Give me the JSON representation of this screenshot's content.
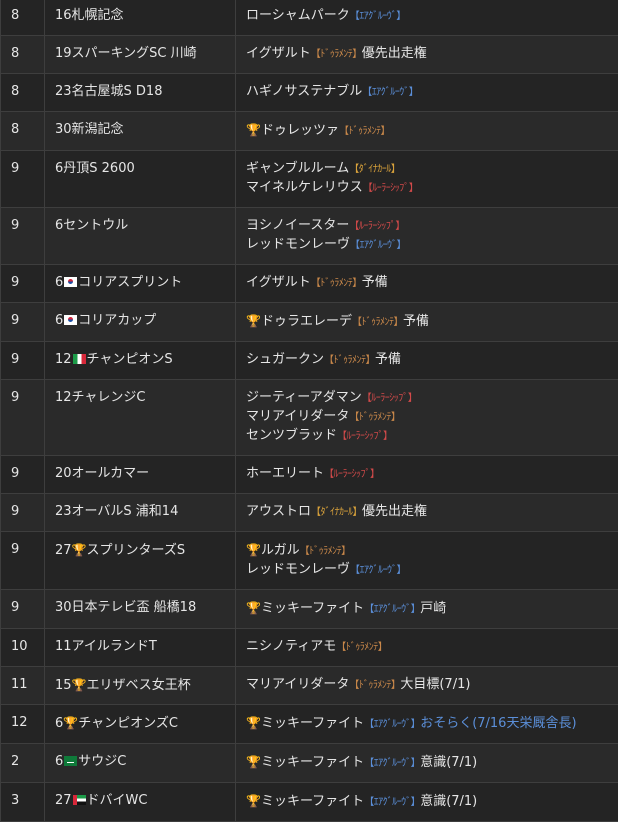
{
  "rows": [
    {
      "month": "8",
      "race": "16札幌記念",
      "horses": [
        {
          "name": "ローシャムパーク",
          "tag": "【ｴｱｸﾞﾙｰｳﾞ】",
          "tagType": "air"
        }
      ]
    },
    {
      "month": "8",
      "race": "19スパーキングSC 川崎",
      "horses": [
        {
          "name": "イグザルト",
          "tag": "【ﾄﾞｩﾗﾒﾝﾃ】",
          "tagType": "dura",
          "note": "優先出走権"
        }
      ]
    },
    {
      "month": "8",
      "race": "23名古屋城S D18",
      "horses": [
        {
          "name": "ハギノサステナブル",
          "tag": "【ｴｱｸﾞﾙｰｳﾞ】",
          "tagType": "air"
        }
      ]
    },
    {
      "month": "8",
      "race": "30新潟記念",
      "horses": [
        {
          "trophy": true,
          "name": "ドゥレッツァ",
          "tag": "【ﾄﾞｩﾗﾒﾝﾃ】",
          "tagType": "dura"
        }
      ]
    },
    {
      "month": "9",
      "race": "6丹頂S 2600",
      "horses": [
        {
          "name": "ギャンブルルーム",
          "tag": "【ﾀﾞｲﾅｶｰﾙ】",
          "tagType": "dyna"
        },
        {
          "name": "マイネルケレリウス",
          "tag": "【ﾙｰﾗｰｼｯﾌﾟ】",
          "tagType": "ruler"
        }
      ]
    },
    {
      "month": "9",
      "race": "6セントウル",
      "horses": [
        {
          "name": "ヨシノイースター",
          "tag": "【ﾙｰﾗｰｼｯﾌﾟ】",
          "tagType": "ruler"
        },
        {
          "name": "レッドモンレーヴ",
          "tag": "【ｴｱｸﾞﾙｰｳﾞ】",
          "tagType": "air"
        }
      ]
    },
    {
      "month": "9",
      "race": "6",
      "flag": "kr",
      "race2": "コリアスプリント",
      "horses": [
        {
          "name": "イグザルト",
          "tag": "【ﾄﾞｩﾗﾒﾝﾃ】",
          "tagType": "dura",
          "note": "予備"
        }
      ]
    },
    {
      "month": "9",
      "race": "6",
      "flag": "kr",
      "race2": "コリアカップ",
      "horses": [
        {
          "trophy": true,
          "name": "ドゥラエレーデ",
          "tag": "【ﾄﾞｩﾗﾒﾝﾃ】",
          "tagType": "dura",
          "note": "予備"
        }
      ]
    },
    {
      "month": "9",
      "race": "12",
      "flag": "it",
      "race2": "チャンピオンS",
      "horses": [
        {
          "name": "シュガークン",
          "tag": "【ﾄﾞｩﾗﾒﾝﾃ】",
          "tagType": "dura",
          "note": "予備"
        }
      ]
    },
    {
      "month": "9",
      "race": "12チャレンジC",
      "horses": [
        {
          "name": "ジーティーアダマン",
          "tag": "【ﾙｰﾗｰｼｯﾌﾟ】",
          "tagType": "ruler"
        },
        {
          "name": "マリアイリダータ",
          "tag": "【ﾄﾞｩﾗﾒﾝﾃ】",
          "tagType": "dura"
        },
        {
          "name": "センツブラッド",
          "tag": "【ﾙｰﾗｰｼｯﾌﾟ】",
          "tagType": "ruler"
        }
      ]
    },
    {
      "month": "9",
      "race": "20オールカマー",
      "horses": [
        {
          "name": "ホーエリート",
          "tag": "【ﾙｰﾗｰｼｯﾌﾟ】",
          "tagType": "ruler"
        }
      ]
    },
    {
      "month": "9",
      "race": "23オーバルS 浦和14",
      "horses": [
        {
          "name": "アウストロ",
          "tag": "【ﾀﾞｲﾅｶｰﾙ】",
          "tagType": "dyna",
          "note": "優先出走権"
        }
      ]
    },
    {
      "month": "9",
      "race": "27",
      "trophy": true,
      "race2": "スプリンターズS",
      "horses": [
        {
          "trophy": true,
          "name": "ルガル",
          "tag": "【ﾄﾞｩﾗﾒﾝﾃ】",
          "tagType": "dura"
        },
        {
          "name": "レッドモンレーヴ",
          "tag": "【ｴｱｸﾞﾙｰｳﾞ】",
          "tagType": "air"
        }
      ]
    },
    {
      "month": "9",
      "race": "30日本テレビ盃 船橋18",
      "horses": [
        {
          "trophy": true,
          "name": "ミッキーファイト",
          "tag": "【ｴｱｸﾞﾙｰｳﾞ】",
          "tagType": "air",
          "note": "戸崎"
        }
      ]
    },
    {
      "month": "10",
      "race": "11アイルランドT",
      "horses": [
        {
          "name": "ニシノティアモ",
          "tag": "【ﾄﾞｩﾗﾒﾝﾃ】",
          "tagType": "dura"
        }
      ]
    },
    {
      "month": "11",
      "race": "15",
      "trophy": true,
      "race2": "エリザベス女王杯",
      "horses": [
        {
          "name": "マリアイリダータ",
          "tag": "【ﾄﾞｩﾗﾒﾝﾃ】",
          "tagType": "dura",
          "note": "大目標(7/1)"
        }
      ]
    },
    {
      "month": "12",
      "race": "6",
      "trophy": true,
      "race2": "チャンピオンズC",
      "horses": [
        {
          "trophy": true,
          "name": "ミッキーファイト",
          "tag": "【ｴｱｸﾞﾙｰｳﾞ】",
          "tagType": "air",
          "note": "おそらく(7/16天栄厩舎長)",
          "noteType": "air"
        }
      ]
    },
    {
      "month": "2",
      "race": "6",
      "flag": "sa",
      "race2": "サウジC",
      "horses": [
        {
          "trophy": true,
          "name": "ミッキーファイト",
          "tag": "【ｴｱｸﾞﾙｰｳﾞ】",
          "tagType": "air",
          "note": "意識(7/1)"
        }
      ]
    },
    {
      "month": "3",
      "race": "27",
      "flag": "ae",
      "race2": "ドバイWC",
      "horses": [
        {
          "trophy": true,
          "name": "ミッキーファイト",
          "tag": "【ｴｱｸﾞﾙｰｳﾞ】",
          "tagType": "air",
          "note": "意識(7/1)"
        }
      ]
    }
  ]
}
